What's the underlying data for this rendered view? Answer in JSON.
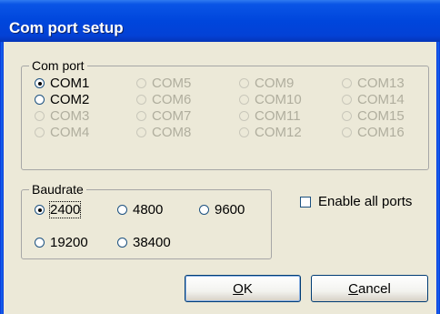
{
  "window": {
    "title": "Com port setup"
  },
  "com_port_group": {
    "legend": "Com port",
    "columns": [
      [
        {
          "label": "COM1",
          "checked": true,
          "enabled": true
        },
        {
          "label": "COM2",
          "checked": false,
          "enabled": true
        },
        {
          "label": "COM3",
          "checked": false,
          "enabled": false
        },
        {
          "label": "COM4",
          "checked": false,
          "enabled": false
        }
      ],
      [
        {
          "label": "COM5",
          "checked": false,
          "enabled": false
        },
        {
          "label": "COM6",
          "checked": false,
          "enabled": false
        },
        {
          "label": "COM7",
          "checked": false,
          "enabled": false
        },
        {
          "label": "COM8",
          "checked": false,
          "enabled": false
        }
      ],
      [
        {
          "label": "COM9",
          "checked": false,
          "enabled": false
        },
        {
          "label": "COM10",
          "checked": false,
          "enabled": false
        },
        {
          "label": "COM11",
          "checked": false,
          "enabled": false
        },
        {
          "label": "COM12",
          "checked": false,
          "enabled": false
        }
      ],
      [
        {
          "label": "COM13",
          "checked": false,
          "enabled": false
        },
        {
          "label": "COM14",
          "checked": false,
          "enabled": false
        },
        {
          "label": "COM15",
          "checked": false,
          "enabled": false
        },
        {
          "label": "COM16",
          "checked": false,
          "enabled": false
        }
      ]
    ]
  },
  "baudrate_group": {
    "legend": "Baudrate",
    "options": [
      {
        "label": "2400",
        "checked": true
      },
      {
        "label": "4800",
        "checked": false
      },
      {
        "label": "9600",
        "checked": false
      },
      {
        "label": "19200",
        "checked": false
      },
      {
        "label": "38400",
        "checked": false
      }
    ]
  },
  "enable_all_ports": {
    "label": "Enable all ports",
    "checked": false
  },
  "buttons": {
    "ok_accel": "O",
    "ok_rest": "K",
    "cancel_accel": "C",
    "cancel_rest": "ancel"
  }
}
